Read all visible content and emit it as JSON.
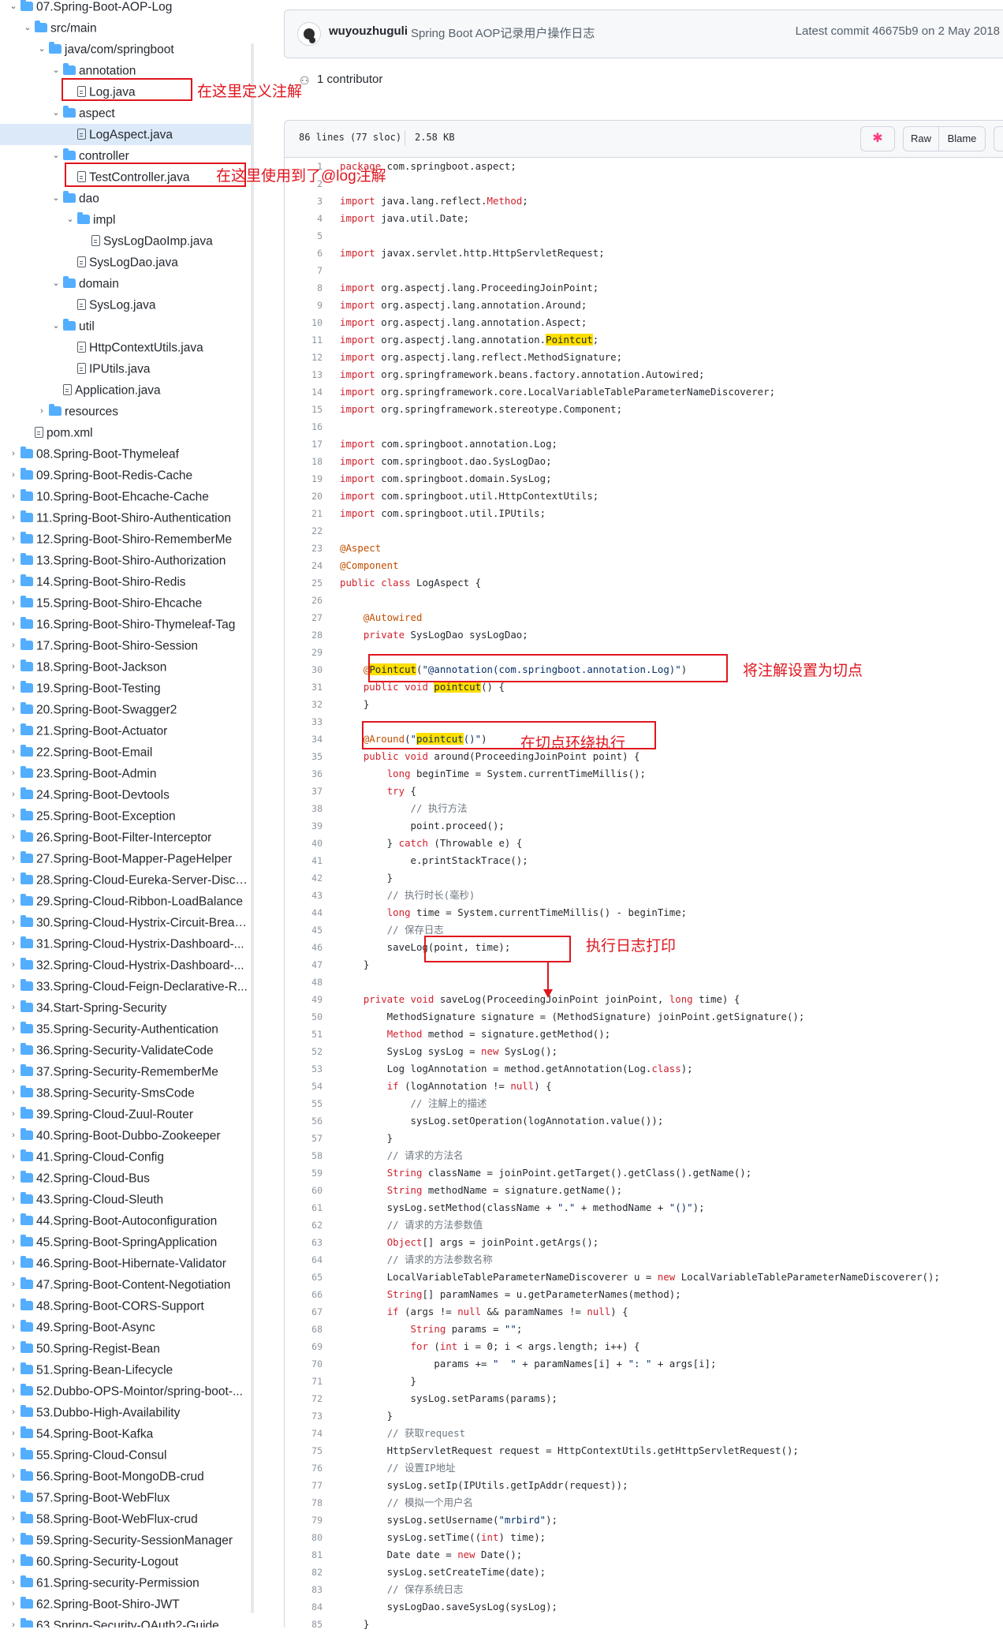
{
  "sidebar": {
    "items": [
      {
        "label": "07.Spring-Boot-AOP-Log",
        "type": "folder",
        "expanded": true,
        "depth": 0
      },
      {
        "label": "src/main",
        "type": "folder",
        "expanded": true,
        "depth": 1
      },
      {
        "label": "java/com/springboot",
        "type": "folder",
        "expanded": true,
        "depth": 2
      },
      {
        "label": "annotation",
        "type": "folder",
        "expanded": true,
        "depth": 3
      },
      {
        "label": "Log.java",
        "type": "file",
        "depth": 4
      },
      {
        "label": "aspect",
        "type": "folder",
        "expanded": true,
        "depth": 3
      },
      {
        "label": "LogAspect.java",
        "type": "file",
        "depth": 4,
        "selected": true
      },
      {
        "label": "controller",
        "type": "folder",
        "expanded": true,
        "depth": 3
      },
      {
        "label": "TestController.java",
        "type": "file",
        "depth": 4
      },
      {
        "label": "dao",
        "type": "folder",
        "expanded": true,
        "depth": 3
      },
      {
        "label": "impl",
        "type": "folder",
        "expanded": true,
        "depth": 4
      },
      {
        "label": "SysLogDaoImp.java",
        "type": "file",
        "depth": 5
      },
      {
        "label": "SysLogDao.java",
        "type": "file",
        "depth": 4
      },
      {
        "label": "domain",
        "type": "folder",
        "expanded": true,
        "depth": 3
      },
      {
        "label": "SysLog.java",
        "type": "file",
        "depth": 4
      },
      {
        "label": "util",
        "type": "folder",
        "expanded": true,
        "depth": 3
      },
      {
        "label": "HttpContextUtils.java",
        "type": "file",
        "depth": 4
      },
      {
        "label": "IPUtils.java",
        "type": "file",
        "depth": 4
      },
      {
        "label": "Application.java",
        "type": "file",
        "depth": 3
      },
      {
        "label": "resources",
        "type": "folder",
        "expanded": false,
        "depth": 2
      },
      {
        "label": "pom.xml",
        "type": "file",
        "depth": 1
      },
      {
        "label": "08.Spring-Boot-Thymeleaf",
        "type": "folder",
        "expanded": false,
        "depth": 0
      },
      {
        "label": "09.Spring-Boot-Redis-Cache",
        "type": "folder",
        "expanded": false,
        "depth": 0
      },
      {
        "label": "10.Spring-Boot-Ehcache-Cache",
        "type": "folder",
        "expanded": false,
        "depth": 0
      },
      {
        "label": "11.Spring-Boot-Shiro-Authentication",
        "type": "folder",
        "expanded": false,
        "depth": 0
      },
      {
        "label": "12.Spring-Boot-Shiro-RememberMe",
        "type": "folder",
        "expanded": false,
        "depth": 0
      },
      {
        "label": "13.Spring-Boot-Shiro-Authorization",
        "type": "folder",
        "expanded": false,
        "depth": 0
      },
      {
        "label": "14.Spring-Boot-Shiro-Redis",
        "type": "folder",
        "expanded": false,
        "depth": 0
      },
      {
        "label": "15.Spring-Boot-Shiro-Ehcache",
        "type": "folder",
        "expanded": false,
        "depth": 0
      },
      {
        "label": "16.Spring-Boot-Shiro-Thymeleaf-Tag",
        "type": "folder",
        "expanded": false,
        "depth": 0
      },
      {
        "label": "17.Spring-Boot-Shiro-Session",
        "type": "folder",
        "expanded": false,
        "depth": 0
      },
      {
        "label": "18.Spring-Boot-Jackson",
        "type": "folder",
        "expanded": false,
        "depth": 0
      },
      {
        "label": "19.Spring-Boot-Testing",
        "type": "folder",
        "expanded": false,
        "depth": 0
      },
      {
        "label": "20.Spring-Boot-Swagger2",
        "type": "folder",
        "expanded": false,
        "depth": 0
      },
      {
        "label": "21.Spring-Boot-Actuator",
        "type": "folder",
        "expanded": false,
        "depth": 0
      },
      {
        "label": "22.Spring-Boot-Email",
        "type": "folder",
        "expanded": false,
        "depth": 0
      },
      {
        "label": "23.Spring-Boot-Admin",
        "type": "folder",
        "expanded": false,
        "depth": 0
      },
      {
        "label": "24.Spring-Boot-Devtools",
        "type": "folder",
        "expanded": false,
        "depth": 0
      },
      {
        "label": "25.Spring-Boot-Exception",
        "type": "folder",
        "expanded": false,
        "depth": 0
      },
      {
        "label": "26.Spring-Boot-Filter-Interceptor",
        "type": "folder",
        "expanded": false,
        "depth": 0
      },
      {
        "label": "27.Spring-Boot-Mapper-PageHelper",
        "type": "folder",
        "expanded": false,
        "depth": 0
      },
      {
        "label": "28.Spring-Cloud-Eureka-Server-Disco...",
        "type": "folder",
        "expanded": false,
        "depth": 0
      },
      {
        "label": "29.Spring-Cloud-Ribbon-LoadBalance",
        "type": "folder",
        "expanded": false,
        "depth": 0
      },
      {
        "label": "30.Spring-Cloud-Hystrix-Circuit-Break...",
        "type": "folder",
        "expanded": false,
        "depth": 0
      },
      {
        "label": "31.Spring-Cloud-Hystrix-Dashboard-...",
        "type": "folder",
        "expanded": false,
        "depth": 0
      },
      {
        "label": "32.Spring-Cloud-Hystrix-Dashboard-...",
        "type": "folder",
        "expanded": false,
        "depth": 0
      },
      {
        "label": "33.Spring-Cloud-Feign-Declarative-R...",
        "type": "folder",
        "expanded": false,
        "depth": 0
      },
      {
        "label": "34.Start-Spring-Security",
        "type": "folder",
        "expanded": false,
        "depth": 0
      },
      {
        "label": "35.Spring-Security-Authentication",
        "type": "folder",
        "expanded": false,
        "depth": 0
      },
      {
        "label": "36.Spring-Security-ValidateCode",
        "type": "folder",
        "expanded": false,
        "depth": 0
      },
      {
        "label": "37.Spring-Security-RememberMe",
        "type": "folder",
        "expanded": false,
        "depth": 0
      },
      {
        "label": "38.Spring-Security-SmsCode",
        "type": "folder",
        "expanded": false,
        "depth": 0
      },
      {
        "label": "39.Spring-Cloud-Zuul-Router",
        "type": "folder",
        "expanded": false,
        "depth": 0
      },
      {
        "label": "40.Spring-Boot-Dubbo-Zookeeper",
        "type": "folder",
        "expanded": false,
        "depth": 0
      },
      {
        "label": "41.Spring-Cloud-Config",
        "type": "folder",
        "expanded": false,
        "depth": 0
      },
      {
        "label": "42.Spring-Cloud-Bus",
        "type": "folder",
        "expanded": false,
        "depth": 0
      },
      {
        "label": "43.Spring-Cloud-Sleuth",
        "type": "folder",
        "expanded": false,
        "depth": 0
      },
      {
        "label": "44.Spring-Boot-Autoconfiguration",
        "type": "folder",
        "expanded": false,
        "depth": 0
      },
      {
        "label": "45.Spring-Boot-SpringApplication",
        "type": "folder",
        "expanded": false,
        "depth": 0
      },
      {
        "label": "46.Spring-Boot-Hibernate-Validator",
        "type": "folder",
        "expanded": false,
        "depth": 0
      },
      {
        "label": "47.Spring-Boot-Content-Negotiation",
        "type": "folder",
        "expanded": false,
        "depth": 0
      },
      {
        "label": "48.Spring-Boot-CORS-Support",
        "type": "folder",
        "expanded": false,
        "depth": 0
      },
      {
        "label": "49.Spring-Boot-Async",
        "type": "folder",
        "expanded": false,
        "depth": 0
      },
      {
        "label": "50.Spring-Regist-Bean",
        "type": "folder",
        "expanded": false,
        "depth": 0
      },
      {
        "label": "51.Spring-Bean-Lifecycle",
        "type": "folder",
        "expanded": false,
        "depth": 0
      },
      {
        "label": "52.Dubbo-OPS-Mointor/spring-boot-...",
        "type": "folder",
        "expanded": false,
        "depth": 0
      },
      {
        "label": "53.Dubbo-High-Availability",
        "type": "folder",
        "expanded": false,
        "depth": 0
      },
      {
        "label": "54.Spring-Boot-Kafka",
        "type": "folder",
        "expanded": false,
        "depth": 0
      },
      {
        "label": "55.Spring-Cloud-Consul",
        "type": "folder",
        "expanded": false,
        "depth": 0
      },
      {
        "label": "56.Spring-Boot-MongoDB-crud",
        "type": "folder",
        "expanded": false,
        "depth": 0
      },
      {
        "label": "57.Spring-Boot-WebFlux",
        "type": "folder",
        "expanded": false,
        "depth": 0
      },
      {
        "label": "58.Spring-Boot-WebFlux-crud",
        "type": "folder",
        "expanded": false,
        "depth": 0
      },
      {
        "label": "59.Spring-Security-SessionManager",
        "type": "folder",
        "expanded": false,
        "depth": 0
      },
      {
        "label": "60.Spring-Security-Logout",
        "type": "folder",
        "expanded": false,
        "depth": 0
      },
      {
        "label": "61.Spring-security-Permission",
        "type": "folder",
        "expanded": false,
        "depth": 0
      },
      {
        "label": "62.Spring-Boot-Shiro-JWT",
        "type": "folder",
        "expanded": false,
        "depth": 0
      },
      {
        "label": "63.Spring-Security-OAuth2-Guide",
        "type": "folder",
        "expanded": false,
        "depth": 0
      }
    ]
  },
  "commit": {
    "author": "wuyouzhuguli",
    "message": "Spring Boot AOP记录用户操作日志",
    "meta": "Latest commit 46675b9 on 2 May 2018",
    "contributors": "1 contributor"
  },
  "file_bar": {
    "lines": "86 lines (77 sloc)",
    "size": "2.58 KB",
    "copilot_icon": "✱",
    "raw_label": "Raw",
    "blame_label": "Blame"
  },
  "code": {
    "lines": [
      "package com.springboot.aspect;",
      "",
      "import java.lang.reflect.Method;",
      "import java.util.Date;",
      "",
      "import javax.servlet.http.HttpServletRequest;",
      "",
      "import org.aspectj.lang.ProceedingJoinPoint;",
      "import org.aspectj.lang.annotation.Around;",
      "import org.aspectj.lang.annotation.Aspect;",
      "import org.aspectj.lang.annotation.Pointcut;",
      "import org.aspectj.lang.reflect.MethodSignature;",
      "import org.springframework.beans.factory.annotation.Autowired;",
      "import org.springframework.core.LocalVariableTableParameterNameDiscoverer;",
      "import org.springframework.stereotype.Component;",
      "",
      "import com.springboot.annotation.Log;",
      "import com.springboot.dao.SysLogDao;",
      "import com.springboot.domain.SysLog;",
      "import com.springboot.util.HttpContextUtils;",
      "import com.springboot.util.IPUtils;",
      "",
      "@Aspect",
      "@Component",
      "public class LogAspect {",
      "",
      "\t@Autowired",
      "\tprivate SysLogDao sysLogDao;",
      "",
      "\t@Pointcut(\"@annotation(com.springboot.annotation.Log)\")",
      "\tpublic void pointcut() {",
      "\t}",
      "",
      "\t@Around(\"pointcut()\")",
      "\tpublic void around(ProceedingJoinPoint point) {",
      "\t\tlong beginTime = System.currentTimeMillis();",
      "\t\ttry {",
      "\t\t\t// 执行方法",
      "\t\t\tpoint.proceed();",
      "\t\t} catch (Throwable e) {",
      "\t\t\te.printStackTrace();",
      "\t\t}",
      "\t\t// 执行时长(毫秒)",
      "\t\tlong time = System.currentTimeMillis() - beginTime;",
      "\t\t// 保存日志",
      "\t\tsaveLog(point, time);",
      "\t}",
      "",
      "\tprivate void saveLog(ProceedingJoinPoint joinPoint, long time) {",
      "\t\tMethodSignature signature = (MethodSignature) joinPoint.getSignature();",
      "\t\tMethod method = signature.getMethod();",
      "\t\tSysLog sysLog = new SysLog();",
      "\t\tLog logAnnotation = method.getAnnotation(Log.class);",
      "\t\tif (logAnnotation != null) {",
      "\t\t\t// 注解上的描述",
      "\t\t\tsysLog.setOperation(logAnnotation.value());",
      "\t\t}",
      "\t\t// 请求的方法名",
      "\t\tString className = joinPoint.getTarget().getClass().getName();",
      "\t\tString methodName = signature.getName();",
      "\t\tsysLog.setMethod(className + \".\" + methodName + \"()\");",
      "\t\t// 请求的方法参数值",
      "\t\tObject[] args = joinPoint.getArgs();",
      "\t\t// 请求的方法参数名称",
      "\t\tLocalVariableTableParameterNameDiscoverer u = new LocalVariableTableParameterNameDiscoverer();",
      "\t\tString[] paramNames = u.getParameterNames(method);",
      "\t\tif (args != null && paramNames != null) {",
      "\t\t\tString params = \"\";",
      "\t\t\tfor (int i = 0; i < args.length; i++) {",
      "\t\t\t\tparams += \"  \" + paramNames[i] + \": \" + args[i];",
      "\t\t\t}",
      "\t\t\tsysLog.setParams(params);",
      "\t\t}",
      "\t\t// 获取request",
      "\t\tHttpServletRequest request = HttpContextUtils.getHttpServletRequest();",
      "\t\t// 设置IP地址",
      "\t\tsysLog.setIp(IPUtils.getIpAddr(request));",
      "\t\t// 模拟一个用户名",
      "\t\tsysLog.setUsername(\"mrbird\");",
      "\t\tsysLog.setTime((int) time);",
      "\t\tDate date = new Date();",
      "\t\tsysLog.setCreateTime(date);",
      "\t\t// 保存系统日志",
      "\t\tsysLogDao.saveSysLog(sysLog);",
      "\t}"
    ]
  },
  "annotations": {
    "define_annotation": "在这里定义注解",
    "use_annotation": "在这里使用到了@log注解",
    "set_pointcut": "将注解设置为切点",
    "around_pointcut": "在切点环绕执行",
    "print_log": "执行日志打印"
  },
  "colors": {
    "annotation_red": "#e0151e",
    "highlight_yellow": "#ffdf00",
    "keyword": "#cf222e",
    "annotation_token": "#c24e00",
    "selected_row": "#dbe9f9",
    "folder": "#54aeff"
  }
}
